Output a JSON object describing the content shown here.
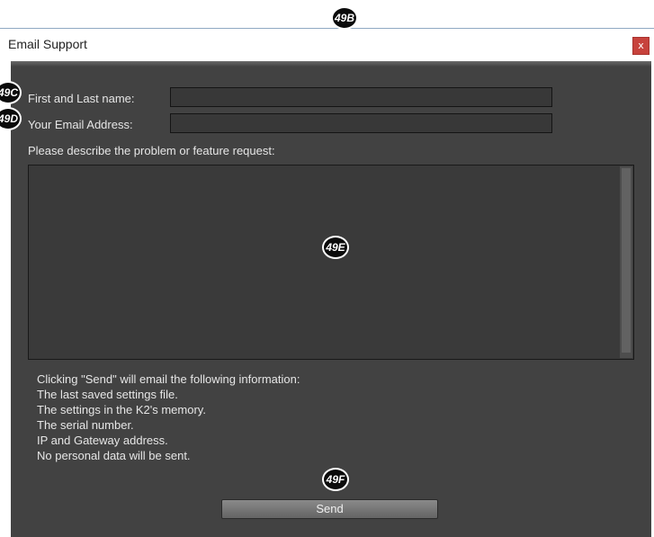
{
  "callouts": {
    "b": "49B",
    "c": "49C",
    "d": "49D",
    "e": "49E",
    "f": "49F"
  },
  "window": {
    "title": "Email Support",
    "close_label": "x"
  },
  "form": {
    "name_label": "First and Last name:",
    "name_value": "",
    "email_label": "Your Email Address:",
    "email_value": "",
    "description_label": "Please describe the problem or feature request:",
    "description_value": ""
  },
  "info": {
    "lines": [
      "Clicking \"Send\" will email the following information:",
      "The last saved settings file.",
      "The settings in the K2's memory.",
      "The serial number.",
      "IP and Gateway address.",
      "No personal data will be sent."
    ]
  },
  "send": {
    "label": "Send"
  },
  "colors": {
    "dialog_bg": "#424242",
    "close_button": "#c7423c",
    "callout_bg": "#0b0b0b"
  }
}
